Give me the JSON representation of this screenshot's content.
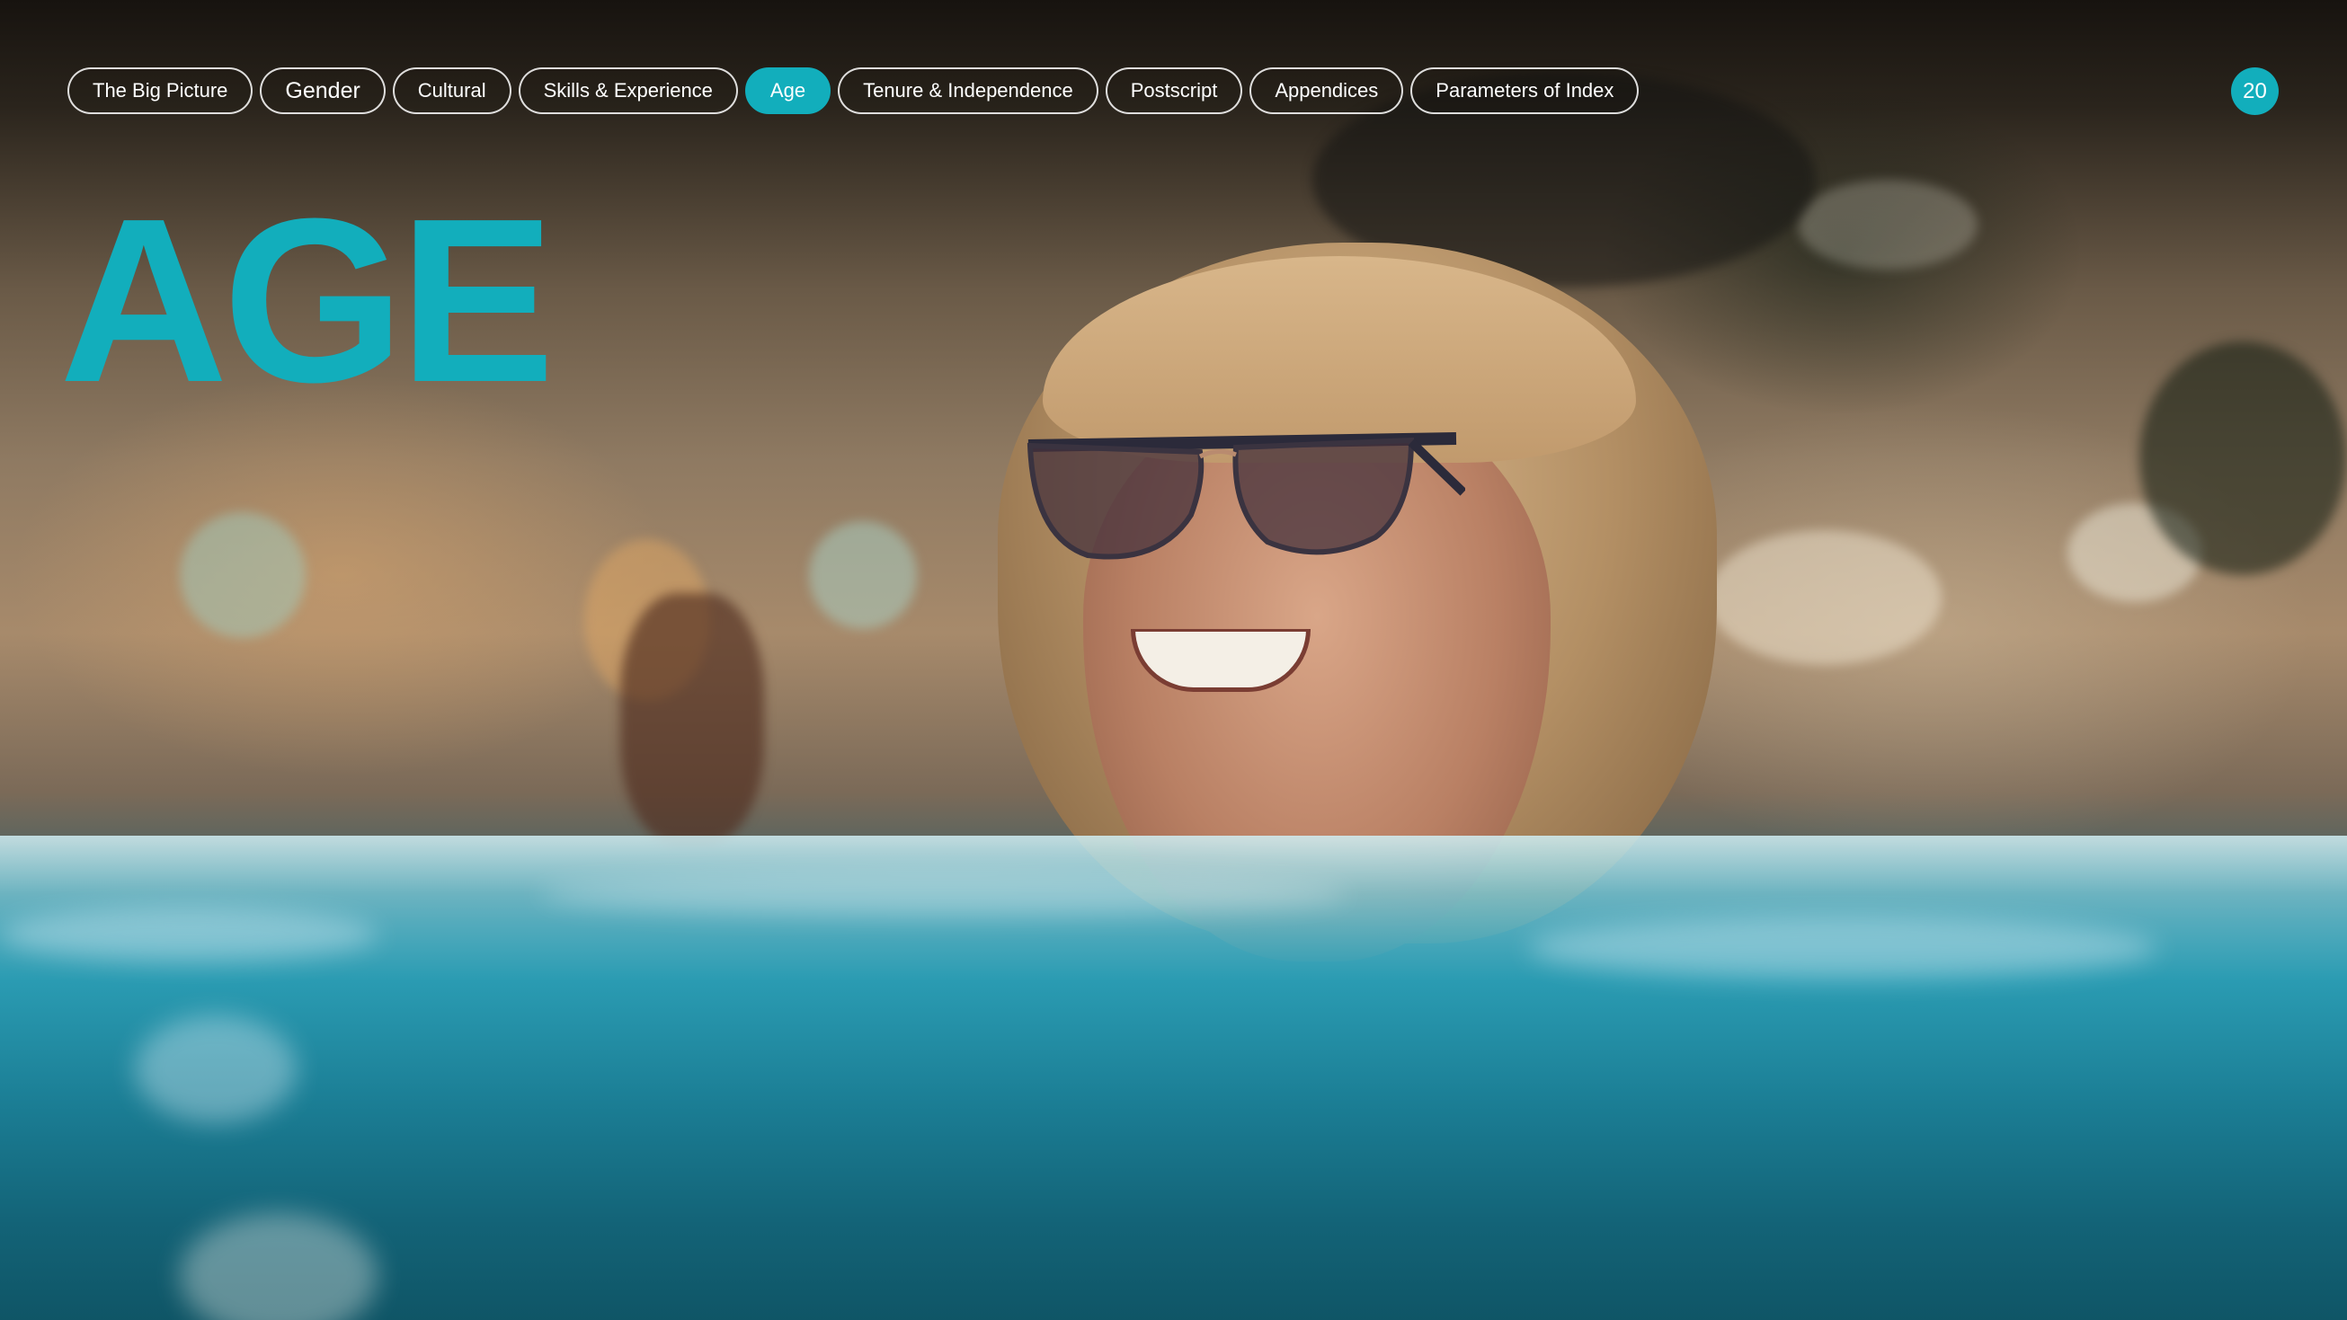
{
  "nav": {
    "items": [
      {
        "label": "The Big Picture",
        "active": false
      },
      {
        "label": "Gender",
        "active": false
      },
      {
        "label": "Cultural",
        "active": false
      },
      {
        "label": "Skills & Experience",
        "active": false
      },
      {
        "label": "Age",
        "active": true
      },
      {
        "label": "Tenure & Independence",
        "active": false
      },
      {
        "label": "Postscript",
        "active": false
      },
      {
        "label": "Appendices",
        "active": false
      },
      {
        "label": "Parameters of Index",
        "active": false
      }
    ]
  },
  "page": {
    "number": "20",
    "title": "AGE"
  },
  "colors": {
    "accent": "#12aebc",
    "pill_border": "#ffffff",
    "text_light": "#ffffff"
  },
  "background": {
    "icon": "photo-woman-in-pool"
  }
}
